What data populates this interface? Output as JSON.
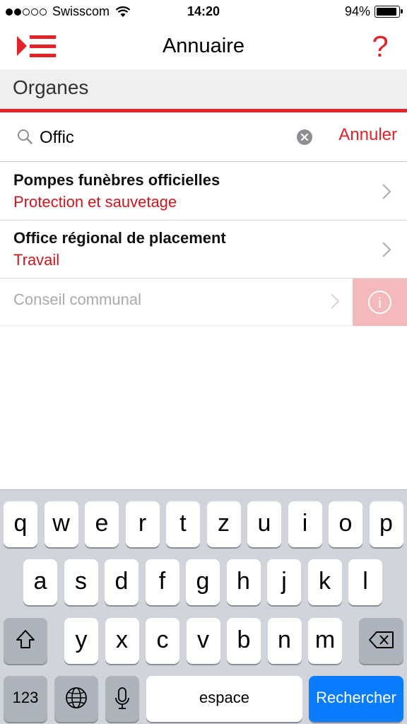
{
  "status_bar": {
    "carrier": "Swisscom",
    "time": "14:20",
    "battery": "94%"
  },
  "nav": {
    "title": "Annuaire",
    "help": "?"
  },
  "section": {
    "title": "Organes"
  },
  "search": {
    "value": "Offic",
    "cancel_label": "Annuler"
  },
  "results": [
    {
      "title": "Pompes funèbres officielles",
      "subtitle": "Protection et sauvetage"
    },
    {
      "title": "Office régional de placement",
      "subtitle": "Travail"
    },
    {
      "title": "Conseil communal"
    }
  ],
  "info_label": "i",
  "keyboard": {
    "row1": [
      "q",
      "w",
      "e",
      "r",
      "t",
      "z",
      "u",
      "i",
      "o",
      "p"
    ],
    "row2": [
      "a",
      "s",
      "d",
      "f",
      "g",
      "h",
      "j",
      "k",
      "l"
    ],
    "row3": [
      "y",
      "x",
      "c",
      "v",
      "b",
      "n",
      "m"
    ],
    "numbers_label": "123",
    "space_label": "espace",
    "return_label": "Rechercher"
  },
  "colors": {
    "accent": "#e2232a",
    "keyboard_bg": "#d1d5db",
    "return_key": "#0a7cff"
  }
}
